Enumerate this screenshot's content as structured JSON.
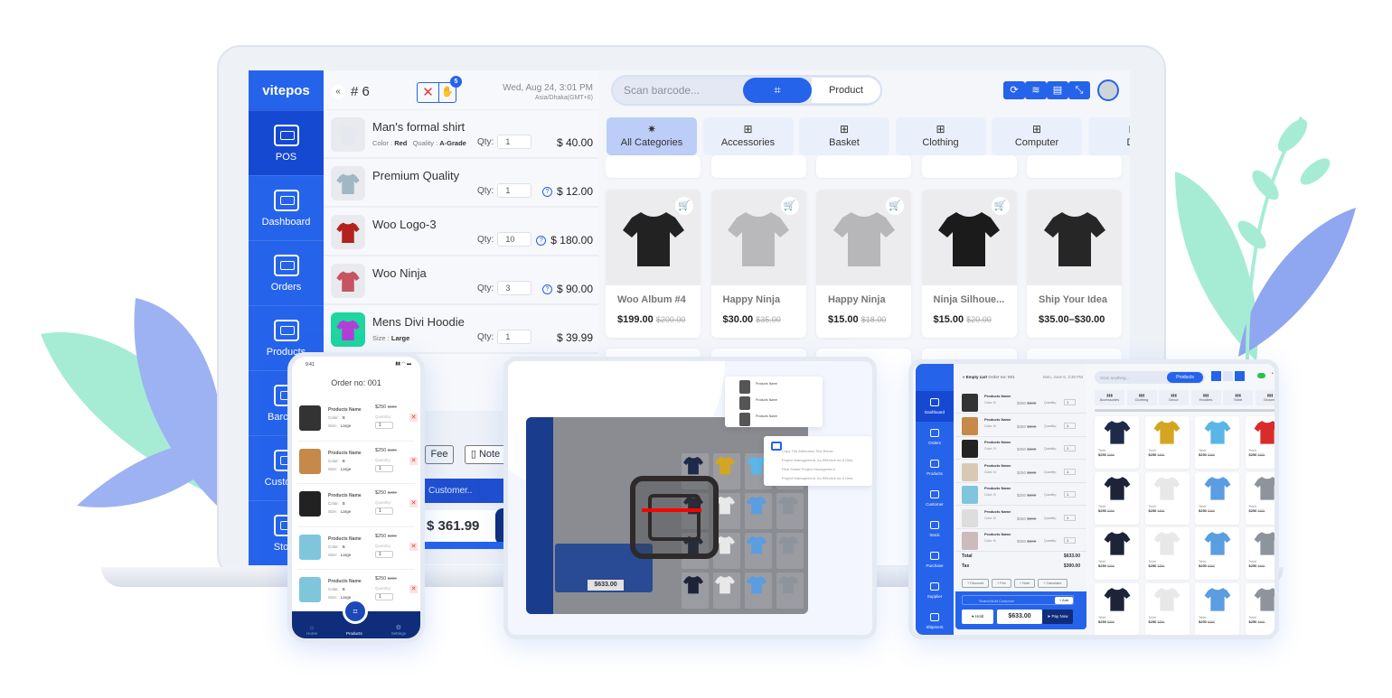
{
  "colors": {
    "brand": "#2563eb",
    "brand_dark": "#1649d2",
    "navy": "#0f2d7a",
    "danger": "#e53935",
    "leaf_green": "#8fe3c6",
    "leaf_blue": "#8fa6f0"
  },
  "laptop": {
    "logo": "vitepos",
    "sidebar": [
      {
        "label": "POS",
        "icon": "pos-terminal-icon",
        "active": true
      },
      {
        "label": "Dashboard",
        "icon": "dashboard-icon"
      },
      {
        "label": "Orders",
        "icon": "orders-icon"
      },
      {
        "label": "Products",
        "icon": "products-icon"
      },
      {
        "label": "Barcode",
        "icon": "barcode-icon"
      },
      {
        "label": "Customer",
        "icon": "customer-icon"
      },
      {
        "label": "Stock",
        "icon": "stock-icon"
      }
    ],
    "cart": {
      "order_no": "# 6",
      "hold_count": "5",
      "date": "Wed, Aug 24, 3:01 PM",
      "timezone": "Asia/Dhaka(GMT+6)",
      "qty_label": "Qty:",
      "items": [
        {
          "name": "Man's formal shirt",
          "meta": [
            [
              "Color",
              "Red"
            ],
            [
              "Quality",
              "A-Grade"
            ]
          ],
          "qty": "1",
          "price": "$ 40.00",
          "info": false,
          "color": "#e6e8f0"
        },
        {
          "name": "Premium Quality",
          "meta": [],
          "qty": "1",
          "price": "$ 12.00",
          "info": true,
          "color": "#9fb8c4"
        },
        {
          "name": "Woo Logo-3",
          "meta": [],
          "qty": "10",
          "price": "$ 180.00",
          "info": true,
          "color": "#b3221c"
        },
        {
          "name": "Woo Ninja",
          "meta": [],
          "qty": "3",
          "price": "$ 90.00",
          "info": true,
          "color": "#c65463"
        },
        {
          "name": "Mens Divi Hoodie",
          "meta": [
            [
              "Size",
              "Large"
            ]
          ],
          "qty": "1",
          "price": "$ 39.99",
          "info": false,
          "color": "#b23fd6"
        }
      ],
      "fee_label": "Fee",
      "note_label": "Note",
      "customer_placeholder": "Customer..",
      "total": "$ 361.99"
    },
    "search_placeholder": "Scan barcode...",
    "mode_label": "Product",
    "toolbar_icons": [
      "sync-icon",
      "wifi-icon",
      "store-icon",
      "collapse-icon"
    ],
    "categories": [
      "All Categories",
      "Accessories",
      "Basket",
      "Clothing",
      "Computer",
      "De"
    ],
    "products": [
      {
        "name": "Woo Album #4",
        "price": "$199.00",
        "old": "$200.00",
        "color": "#222"
      },
      {
        "name": "Happy Ninja",
        "price": "$30.00",
        "old": "$35.00",
        "color": "#b9b9bb"
      },
      {
        "name": "Happy Ninja",
        "price": "$15.00",
        "old": "$18.00",
        "color": "#b7b7b9"
      },
      {
        "name": "Ninja Silhoue...",
        "price": "$15.00",
        "old": "$20.00",
        "color": "#1b1b1b"
      },
      {
        "name": "Ship Your Idea",
        "price": "$35.00–$30.00",
        "old": "",
        "color": "#262626"
      }
    ]
  },
  "phone": {
    "time": "9:41",
    "title": "Order no: 001",
    "items": [
      {
        "name": "Products Name",
        "price": "$250",
        "old": "$300",
        "color": "B",
        "size": "Large",
        "qty": "1"
      },
      {
        "name": "Products Name",
        "price": "$250",
        "old": "$300",
        "color": "B",
        "size": "Large",
        "qty": "1"
      },
      {
        "name": "Products Name",
        "price": "$250",
        "old": "$300",
        "color": "B",
        "size": "Large",
        "qty": "1"
      },
      {
        "name": "Products Name",
        "price": "$250",
        "old": "$300",
        "color": "B",
        "size": "Large",
        "qty": "1"
      },
      {
        "name": "Products Name",
        "price": "$250",
        "old": "$300",
        "color": "B",
        "size": "Large",
        "qty": "1"
      }
    ],
    "labels": {
      "color": "Color:",
      "size": "Size:",
      "quantity": "Quantity:"
    },
    "nav": [
      "Home",
      "Products",
      "Settings"
    ]
  },
  "scanner_tablet": {
    "popup_items": [
      "Copy The Attribution Text Below",
      "Project Management, As Effective As It Gets",
      "Real Estate Project Management",
      "Project Management, As Effective As It Gets"
    ],
    "total": "$633.00"
  },
  "tablet": {
    "empty_cart": "Empty cart",
    "order_no": "Order no: 001",
    "date": "Mon, June 6, 3:30 PM",
    "sidebar": [
      "Dashboard",
      "Orders",
      "Products",
      "Customer",
      "Stock",
      "Purchase",
      "Supplier",
      "Shipment"
    ],
    "cart_item": {
      "name": "Products Name",
      "price": "$250",
      "old": "$300",
      "qty_label": "Quantity:",
      "qty": "1",
      "color_label": "Color:",
      "color": "B"
    },
    "cart_rows": 7,
    "total_label": "Total",
    "total": "$633.00",
    "tax_label": "Tax",
    "tax": "$300.00",
    "actions": [
      "Discount",
      "Fee",
      "Note",
      "Calculator"
    ],
    "customer_placeholder": "Search/Add Customer",
    "add_label": "Add",
    "hold_label": "Hold",
    "pay_total": "$633.00",
    "pay_label": "Pay Now",
    "search_placeholder": "Scan anything...",
    "products_label": "Products",
    "categories": [
      "Accessories",
      "Clothing",
      "Decor",
      "Hoodies",
      "Tshirt",
      "Grocery"
    ],
    "grid_item": {
      "name": "Tshirt",
      "price": "$250",
      "old": "$300"
    },
    "grid_colors": [
      "#1d2a4a",
      "#d4a520",
      "#5ab6e6",
      "#d92b2b",
      "#1d2438",
      "#e8e8e8",
      "#5a9de0",
      "#8e949c",
      "#1d2438",
      "#e8e8e8",
      "#5a9de0",
      "#8e949c",
      "#1d2438",
      "#e8e8e8",
      "#5a9de0",
      "#8e949c"
    ]
  }
}
